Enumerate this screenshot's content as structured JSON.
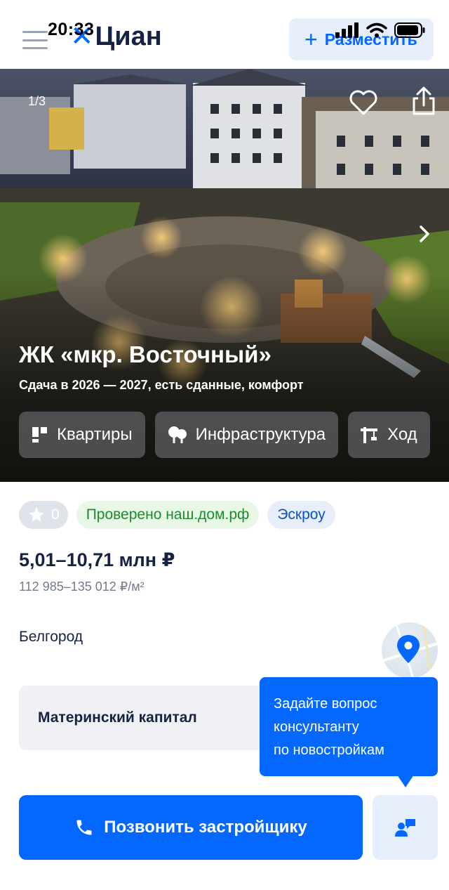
{
  "status_bar": {
    "time": "20:33"
  },
  "header": {
    "logo_text": "Циан",
    "post_button_label": "Разместить"
  },
  "hero": {
    "photo_counter": "1/3",
    "title": "ЖК «мкр. Восточный»",
    "subtitle": "Сдача в 2026 — 2027, есть сданные, комфорт",
    "chips": [
      {
        "label": "Квартиры",
        "icon": "grid-icon"
      },
      {
        "label": "Инфраструктура",
        "icon": "trees-icon"
      },
      {
        "label": "Ход",
        "icon": "crane-icon"
      }
    ]
  },
  "badges": {
    "rating": "0",
    "verified": "Проверено наш.дом.рф",
    "escrow": "Эскроу"
  },
  "price": {
    "range": "5,01–10,71 млн ₽",
    "per_m2": "112 985–135 012 ₽/м²"
  },
  "location": {
    "city": "Белгород"
  },
  "feature_card": {
    "label": "Материнский капитал"
  },
  "tooltip": {
    "lines": [
      "Задайте вопрос",
      "консультанту",
      "по новостройкам"
    ]
  },
  "actions": {
    "call_label": "Позвонить застройщику"
  },
  "colors": {
    "accent": "#0468ff",
    "text": "#152242",
    "muted": "#737a8e",
    "verified_green": "#1e8a2e"
  }
}
